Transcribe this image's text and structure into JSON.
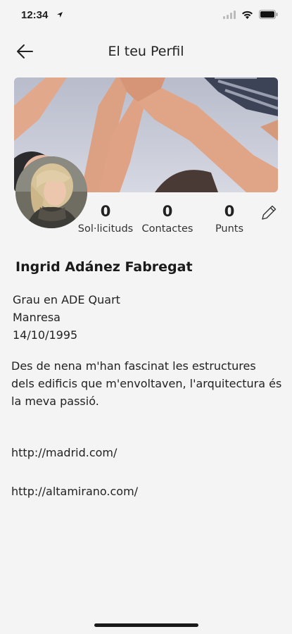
{
  "status_bar": {
    "time": "12:34"
  },
  "header": {
    "title": "El teu Perfil"
  },
  "profile": {
    "name": "Ingrid Adánez Fabregat",
    "stats": [
      {
        "value": "0",
        "label": "Sol·licituds"
      },
      {
        "value": "0",
        "label": "Contactes"
      },
      {
        "value": "0",
        "label": "Punts"
      }
    ],
    "study": "Grau en ADE Quart",
    "city": "Manresa",
    "birthdate": "14/10/1995",
    "bio": "Des de nena m'han fascinat les estructures dels edificis que m'envoltaven, l'arquitectura és la meva passió.",
    "links": [
      "http://madrid.com/",
      "http://altamirano.com/"
    ]
  },
  "icons": {
    "back": "arrow-left-icon",
    "edit": "pencil-icon",
    "location": "location-arrow-icon",
    "signal": "cellular-signal-icon",
    "wifi": "wifi-icon",
    "battery": "battery-icon"
  }
}
